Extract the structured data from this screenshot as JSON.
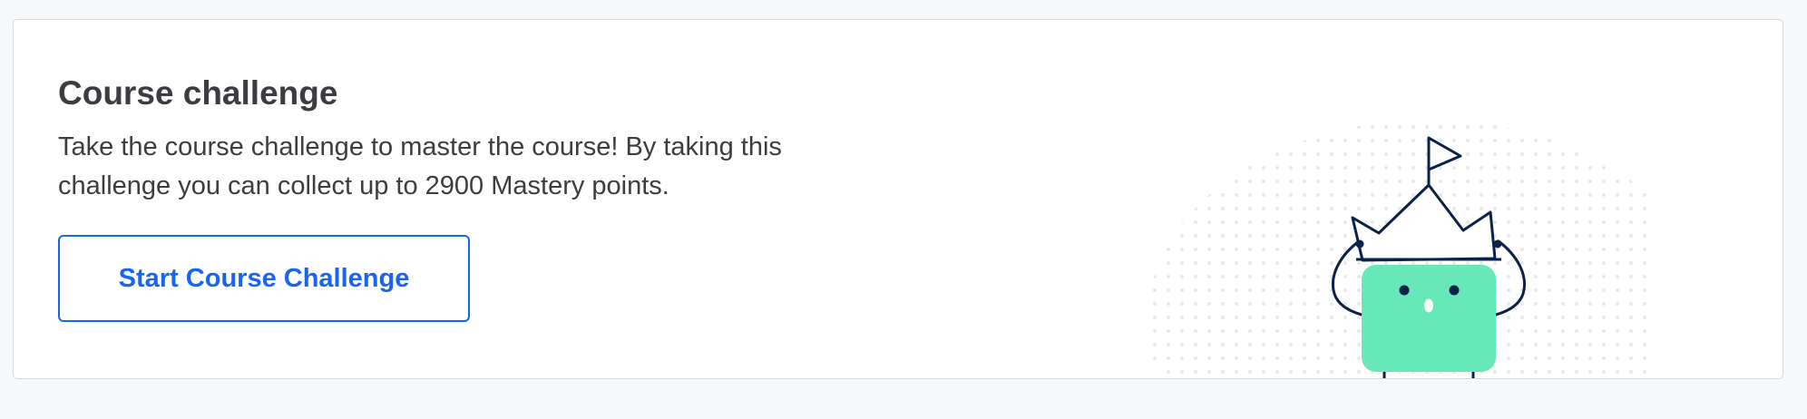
{
  "challenge_card": {
    "title": "Course challenge",
    "description": "Take the course challenge to master the course! By taking this challenge you can collect up to 2900 Mastery points.",
    "button_label": "Start Course Challenge",
    "illustration": "crowned-character-with-flag",
    "colors": {
      "accent": "#1865f2",
      "character": "#66e8b8",
      "outline": "#0b2149",
      "dots": "#e6e8eb"
    }
  }
}
